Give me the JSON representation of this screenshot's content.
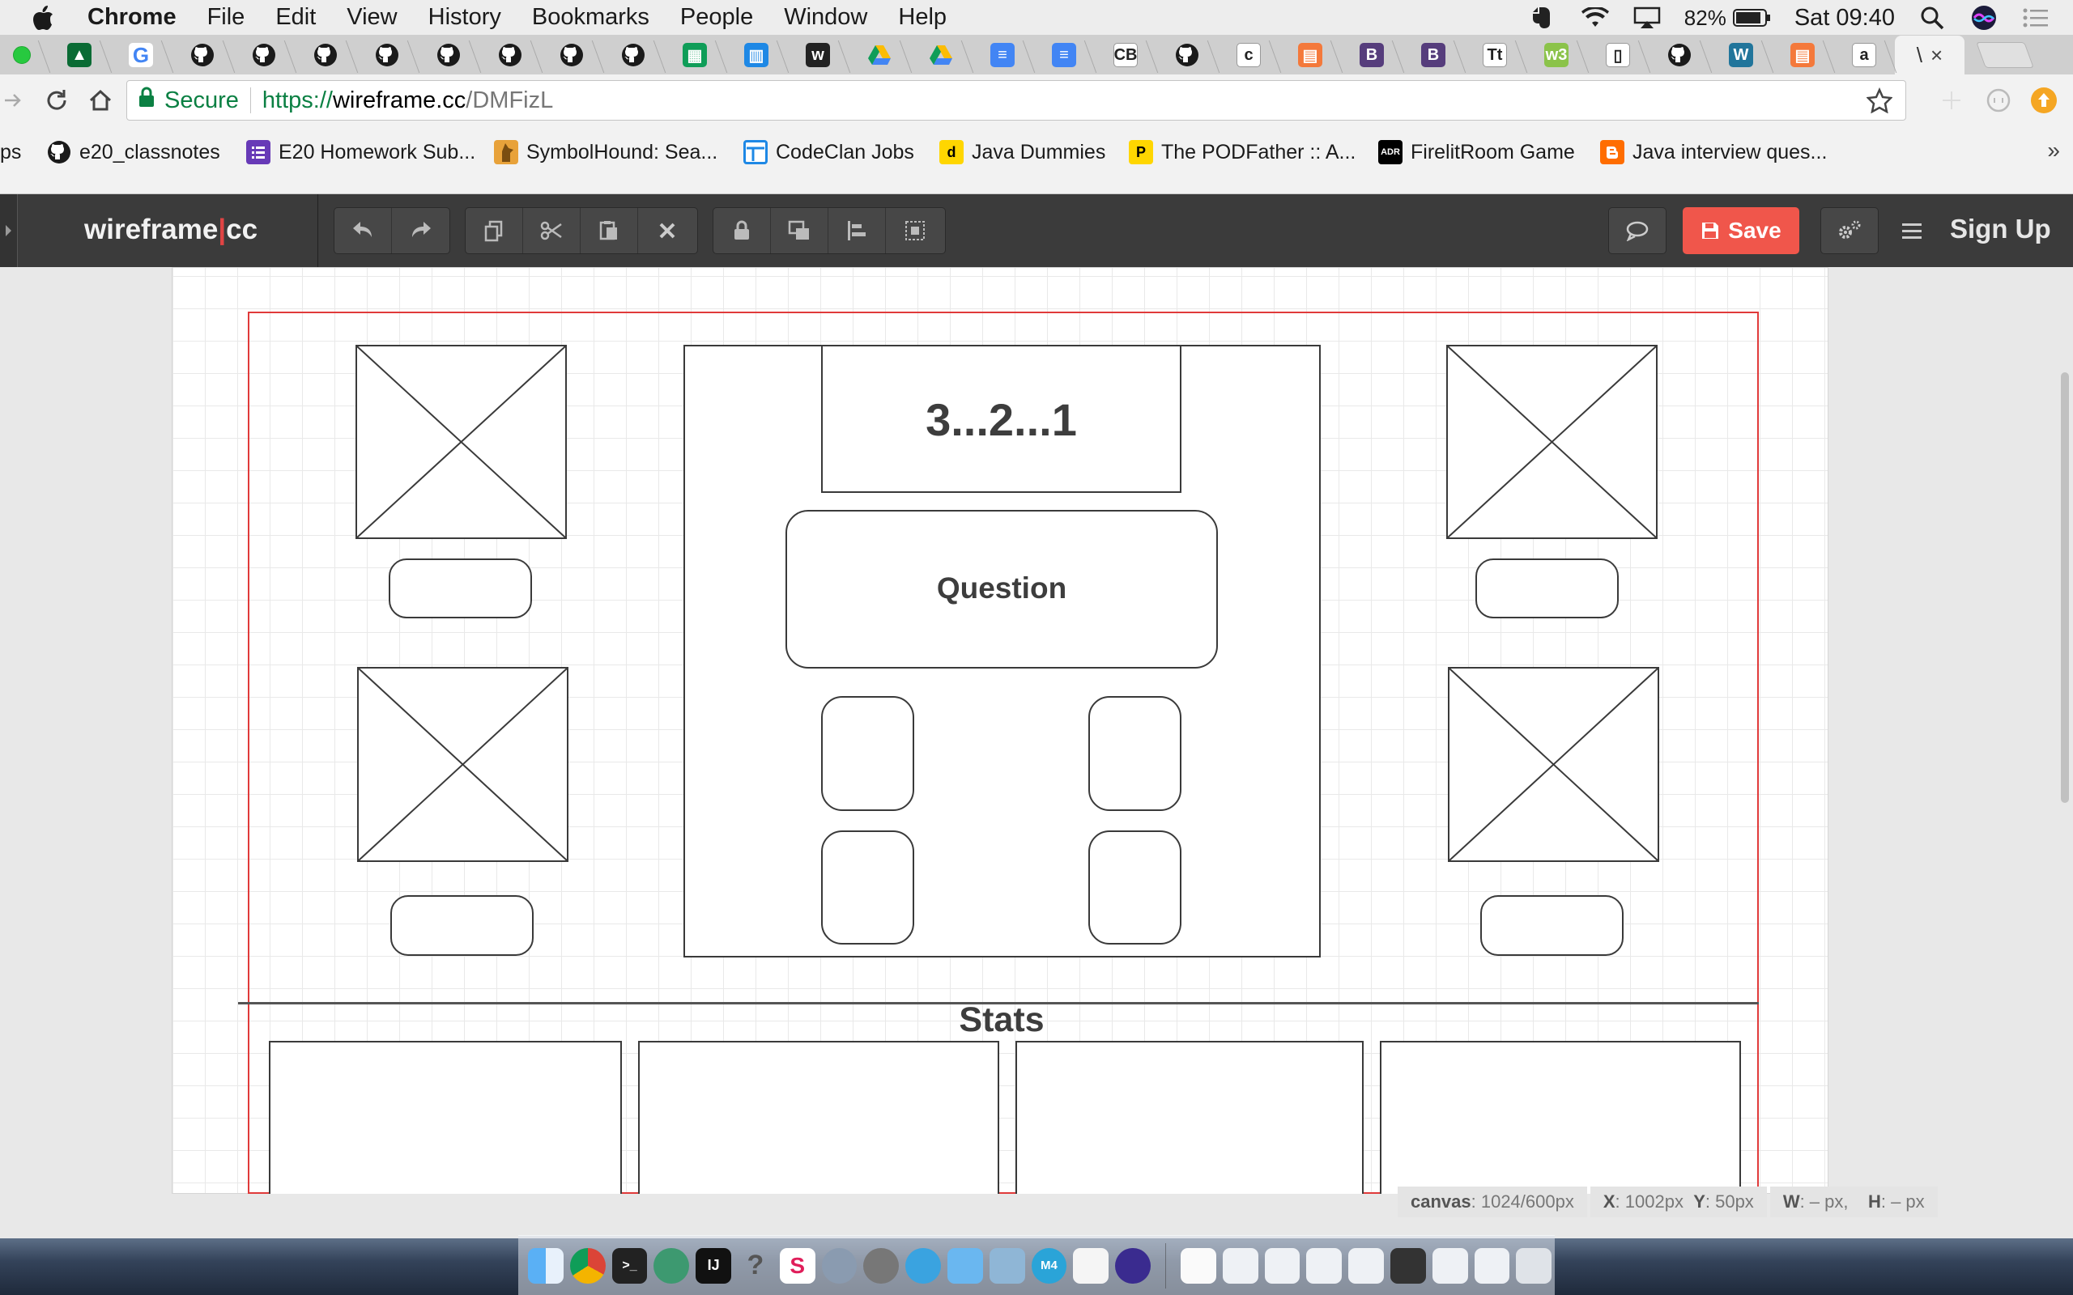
{
  "menubar": {
    "app": "Chrome",
    "items": [
      "File",
      "Edit",
      "View",
      "History",
      "Bookmarks",
      "People",
      "Window",
      "Help"
    ],
    "battery": "82%",
    "clock": "Sat 09:40"
  },
  "tabs": {
    "favicons": [
      "freeCodeCamp",
      "G",
      "github",
      "github",
      "github",
      "github",
      "github",
      "github",
      "github",
      "github",
      "sheets",
      "layout",
      "w",
      "drive",
      "drive",
      "docs",
      "docs",
      "CB",
      "github",
      "c",
      "html",
      "B",
      "B",
      "Tt",
      "w3",
      "file",
      "github",
      "wordpress",
      "html",
      "a"
    ],
    "active_label": "\\",
    "active_close": "×"
  },
  "address": {
    "secure_label": "Secure",
    "url_scheme": "https://",
    "url_host": "wireframe.cc",
    "url_path": "/DMFizL"
  },
  "bookmarks": {
    "items": [
      {
        "label": "ps",
        "icon": "apps"
      },
      {
        "label": "e20_classnotes",
        "icon": "github"
      },
      {
        "label": "E20 Homework Sub...",
        "icon": "list"
      },
      {
        "label": "SymbolHound: Sea...",
        "icon": "hound"
      },
      {
        "label": "CodeClan Jobs",
        "icon": "layout"
      },
      {
        "label": "Java Dummies",
        "icon": "d"
      },
      {
        "label": "The PODFather :: A...",
        "icon": "P"
      },
      {
        "label": "FirelitRoom Game",
        "icon": "ADR"
      },
      {
        "label": "Java interview ques...",
        "icon": "blogger"
      }
    ],
    "more": "»"
  },
  "app": {
    "logo_left": "wireframe",
    "logo_bar": "|",
    "logo_right": "cc",
    "save_label": "Save",
    "signup_label": "Sign Up"
  },
  "wireframe": {
    "timer_text": "3...2...1",
    "question_text": "Question",
    "stats_text": "Stats"
  },
  "status": {
    "canvas_label": "canvas",
    "canvas_value": ": 1024/600px",
    "x_label": "X",
    "x_value": ": 1002px",
    "y_label": "Y",
    "y_value": ": 50px",
    "w_label": "W",
    "w_value": ": – px,",
    "h_label": "H",
    "h_value": ": – px"
  },
  "colors": {
    "save": "#f0564b",
    "frame_border": "#e03a3a",
    "secure_green": "#0b8043",
    "toolbar": "#3b3b3b"
  }
}
